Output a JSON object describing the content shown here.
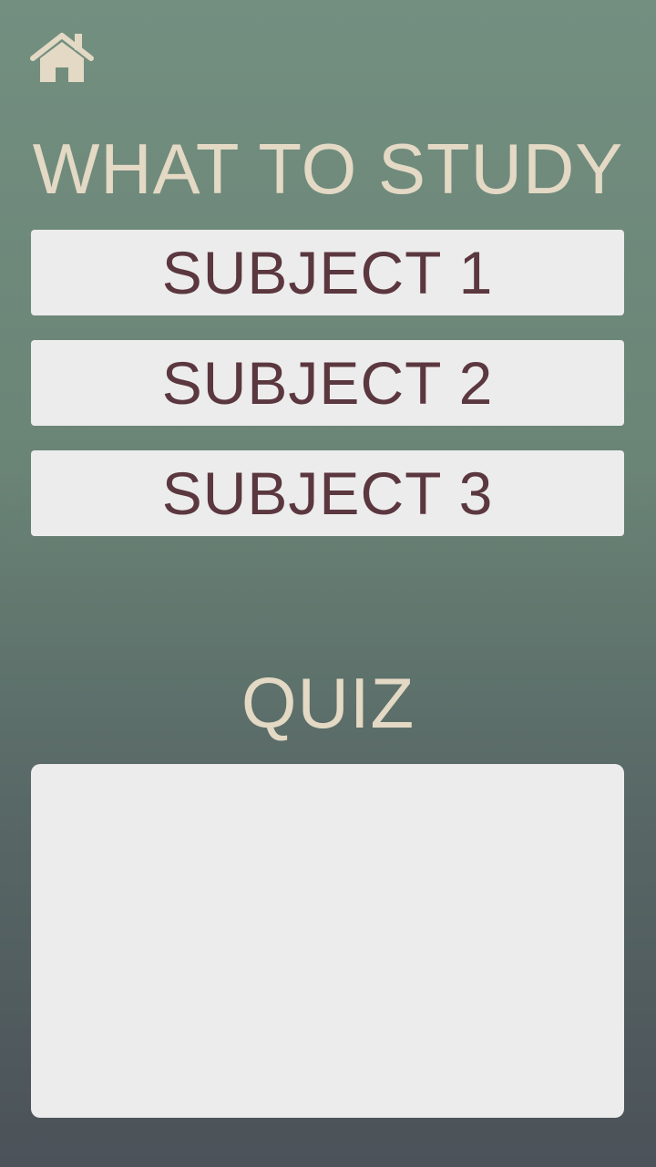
{
  "header": {
    "home_icon": "home-icon",
    "icon_color": "#e3d9c4"
  },
  "study": {
    "title": "WHAT TO STUDY",
    "subjects": [
      {
        "label": "SUBJECT 1"
      },
      {
        "label": "SUBJECT 2"
      },
      {
        "label": "SUBJECT 3"
      }
    ]
  },
  "quiz": {
    "title": "QUIZ"
  },
  "colors": {
    "background_top": "#738f80",
    "background_bottom": "#4b5259",
    "title_text": "#e3d9c4",
    "button_background": "#ececec",
    "button_text": "#5b373f"
  }
}
